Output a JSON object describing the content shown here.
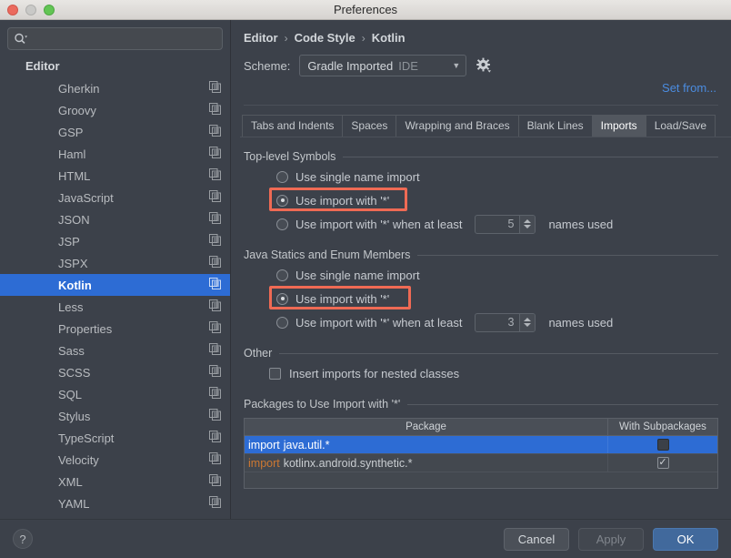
{
  "window": {
    "title": "Preferences",
    "traffic_lights": [
      "close-red",
      "minimize-yellow",
      "zoom-green"
    ]
  },
  "sidebar": {
    "search": {
      "value": "",
      "placeholder": ""
    },
    "group_label": "Editor",
    "items": [
      {
        "label": "Gherkin",
        "selected": false
      },
      {
        "label": "Groovy",
        "selected": false
      },
      {
        "label": "GSP",
        "selected": false
      },
      {
        "label": "Haml",
        "selected": false
      },
      {
        "label": "HTML",
        "selected": false
      },
      {
        "label": "JavaScript",
        "selected": false
      },
      {
        "label": "JSON",
        "selected": false
      },
      {
        "label": "JSP",
        "selected": false
      },
      {
        "label": "JSPX",
        "selected": false
      },
      {
        "label": "Kotlin",
        "selected": true
      },
      {
        "label": "Less",
        "selected": false
      },
      {
        "label": "Properties",
        "selected": false
      },
      {
        "label": "Sass",
        "selected": false
      },
      {
        "label": "SCSS",
        "selected": false
      },
      {
        "label": "SQL",
        "selected": false
      },
      {
        "label": "Stylus",
        "selected": false
      },
      {
        "label": "TypeScript",
        "selected": false
      },
      {
        "label": "Velocity",
        "selected": false
      },
      {
        "label": "XML",
        "selected": false
      },
      {
        "label": "YAML",
        "selected": false
      }
    ]
  },
  "breadcrumb": {
    "parts": [
      "Editor",
      "Code Style",
      "Kotlin"
    ],
    "separator": "›"
  },
  "scheme": {
    "label": "Scheme:",
    "value": "Gradle Imported",
    "suffix": "IDE",
    "arrow": "▼",
    "gear_icon": "gear-icon"
  },
  "set_from_link": "Set from...",
  "tabs": [
    {
      "label": "Tabs and Indents",
      "active": false
    },
    {
      "label": "Spaces",
      "active": false
    },
    {
      "label": "Wrapping and Braces",
      "active": false
    },
    {
      "label": "Blank Lines",
      "active": false
    },
    {
      "label": "Imports",
      "active": true
    },
    {
      "label": "Load/Save",
      "active": false
    }
  ],
  "top_level": {
    "title": "Top-level Symbols",
    "options": [
      {
        "label": "Use single name import",
        "selected": false,
        "highlighted": false
      },
      {
        "label": "Use import with '*'",
        "selected": true,
        "highlighted": true
      },
      {
        "label": "Use import with '*' when at least",
        "selected": false,
        "highlighted": false,
        "spinner_value": "5",
        "suffix": "names used"
      }
    ]
  },
  "java_statics": {
    "title": "Java Statics and Enum Members",
    "options": [
      {
        "label": "Use single name import",
        "selected": false,
        "highlighted": false
      },
      {
        "label": "Use import with '*'",
        "selected": true,
        "highlighted": true
      },
      {
        "label": "Use import with '*' when at least",
        "selected": false,
        "highlighted": false,
        "spinner_value": "3",
        "suffix": "names used"
      }
    ]
  },
  "other": {
    "title": "Other",
    "checkbox_label": "Insert imports for nested classes",
    "checked": false
  },
  "packages": {
    "title": "Packages to Use Import with '*'",
    "columns": [
      "Package",
      "With Subpackages"
    ],
    "rows": [
      {
        "keyword": "import",
        "package": "java.util.*",
        "with_subpackages": false,
        "selected": true
      },
      {
        "keyword": "import",
        "package": "kotlinx.android.synthetic.*",
        "with_subpackages": true,
        "selected": false
      }
    ]
  },
  "footer": {
    "help_label": "?",
    "cancel_label": "Cancel",
    "apply_label": "Apply",
    "ok_label": "OK"
  },
  "colors": {
    "accent_blue": "#2d6cd4",
    "link_blue": "#4b8ce0",
    "highlight_red": "#ef6a54",
    "keyword_orange": "#cc7832",
    "panel_bg": "#3c414a",
    "primary_button": "#41699c"
  }
}
